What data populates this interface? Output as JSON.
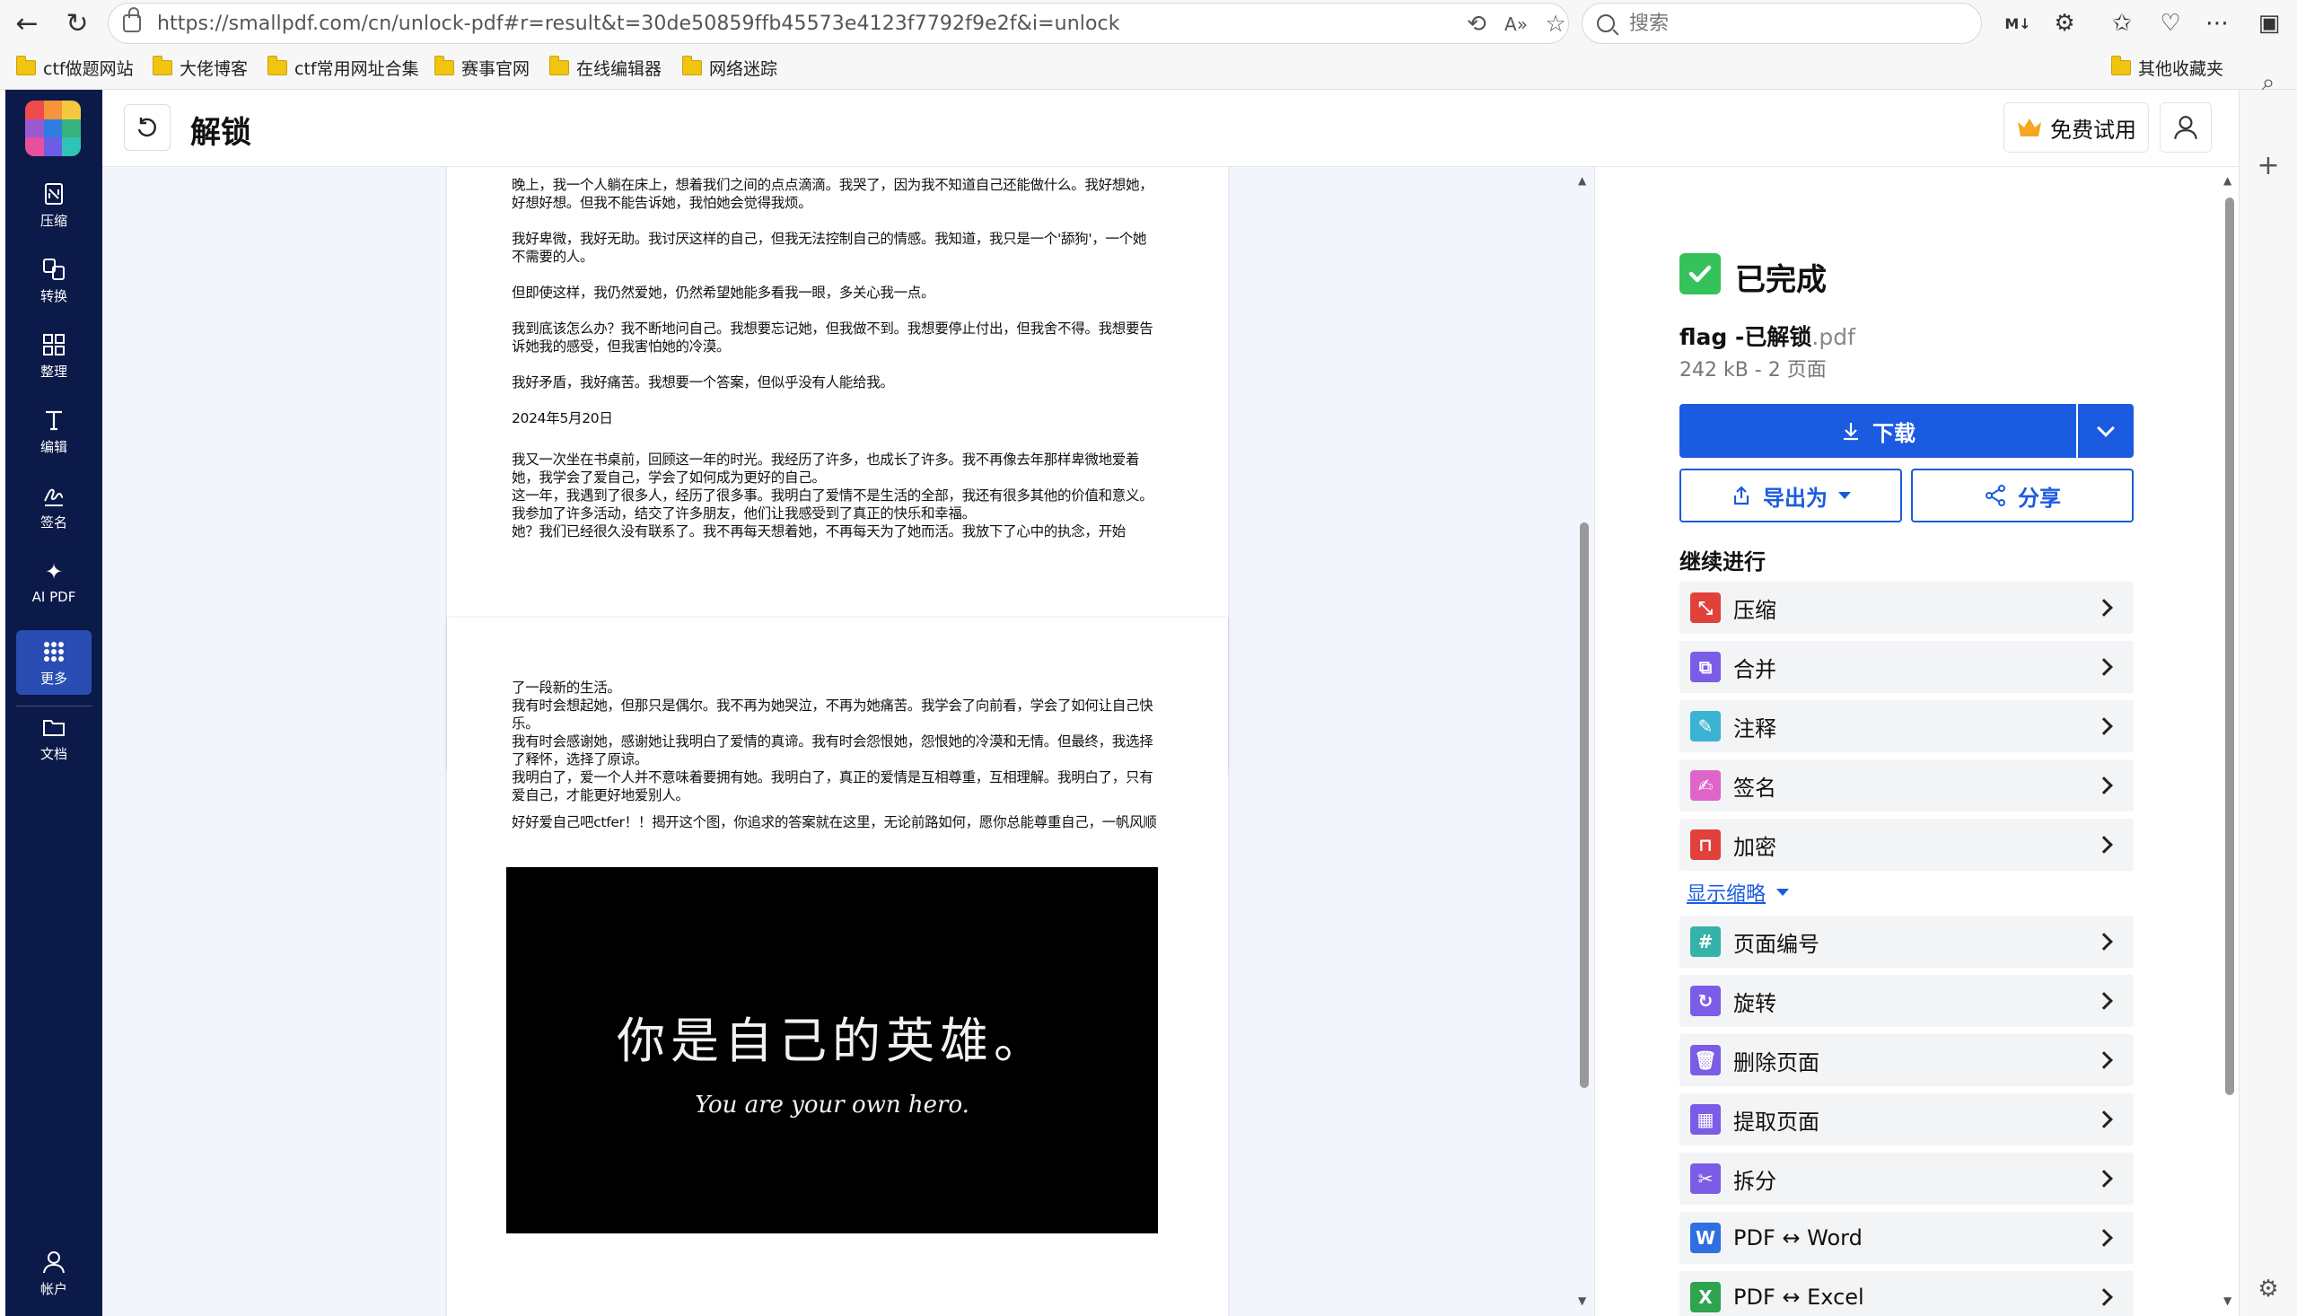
{
  "browser": {
    "url": "https://smallpdf.com/cn/unlock-pdf#r=result&t=30de50859ffb45573e4123f7792f9e2f&i=unlock",
    "search_placeholder": "搜索",
    "bookmarks": [
      "ctf做题网站",
      "大佬博客",
      "ctf常用网址合集",
      "赛事官网",
      "在线编辑器",
      "网络迷踪"
    ],
    "other_bookmarks": "其他收藏夹"
  },
  "sidebar": {
    "items": [
      {
        "label": "压缩",
        "icon": "compress-icon"
      },
      {
        "label": "转换",
        "icon": "convert-icon"
      },
      {
        "label": "整理",
        "icon": "organize-icon"
      },
      {
        "label": "编辑",
        "icon": "edit-icon"
      },
      {
        "label": "签名",
        "icon": "sign-icon"
      },
      {
        "label": "AI PDF",
        "icon": "ai-sparkle-icon"
      },
      {
        "label": "更多",
        "icon": "grid-icon"
      },
      {
        "label": "文档",
        "icon": "folder-icon"
      }
    ],
    "account_label": "帐户"
  },
  "header": {
    "title": "解锁",
    "trial_label": "免费试用"
  },
  "pdf": {
    "page1_paragraphs": [
      "晚上，我一个人躺在床上，想着我们之间的点点滴滴。我哭了，因为我不知道自己还能做什么。我好想她，好想好想。但我不能告诉她，我怕她会觉得我烦。",
      "我好卑微，我好无助。我讨厌这样的自己，但我无法控制自己的情感。我知道，我只是一个'舔狗'，一个她不需要的人。",
      "但即使这样，我仍然爱她，仍然希望她能多看我一眼，多关心我一点。",
      "我到底该怎么办？我不断地问自己。我想要忘记她，但我做不到。我想要停止付出，但我舍不得。我想要告诉她我的感受，但我害怕她的冷漠。",
      "我好矛盾，我好痛苦。我想要一个答案，但似乎没有人能给我。",
      "2024年5月20日",
      "我又一次坐在书桌前，回顾这一年的时光。我经历了许多，也成长了许多。我不再像去年那样卑微地爱着她，我学会了爱自己，学会了如何成为更好的自己。\n这一年，我遇到了很多人，经历了很多事。我明白了爱情不是生活的全部，我还有很多其他的价值和意义。我参加了许多活动，结交了许多朋友，他们让我感受到了真正的快乐和幸福。\n她？我们已经很久没有联系了。我不再每天想着她，不再每天为了她而活。我放下了心中的执念，开始"
    ],
    "page2_paragraphs": [
      "了一段新的生活。\n我有时会想起她，但那只是偶尔。我不再为她哭泣，不再为她痛苦。我学会了向前看，学会了如何让自己快乐。\n我有时会感谢她，感谢她让我明白了爱情的真谛。我有时会怨恨她，怨恨她的冷漠和无情。但最终，我选择了释怀，选择了原谅。\n我明白了，爱一个人并不意味着要拥有她。我明白了，真正的爱情是互相尊重，互相理解。我明白了，只有爱自己，才能更好地爱别人。",
      "好好爱自己吧ctfer！！揭开这个图，你追求的答案就在这里，无论前路如何，愿你总能尊重自己，一帆风顺"
    ],
    "image_text_cn": "你是自己的英雄。",
    "image_text_en": "You are your own hero."
  },
  "result": {
    "status": "已完成",
    "file_base": "flag -已解锁",
    "file_ext": ".pdf",
    "file_meta": "242 kB - 2 页面",
    "download_label": "下载",
    "export_label": "导出为",
    "share_label": "分享",
    "continue_title": "继续进行",
    "show_less": "显示缩略",
    "tools_primary": [
      {
        "label": "压缩",
        "color": "#e0413b"
      },
      {
        "label": "合并",
        "color": "#7b5ce6"
      },
      {
        "label": "注释",
        "color": "#3bb3d3"
      },
      {
        "label": "签名",
        "color": "#e065c8"
      },
      {
        "label": "加密",
        "color": "#e0413b"
      }
    ],
    "tools_more": [
      {
        "label": "页面编号",
        "color": "#35b3a8"
      },
      {
        "label": "旋转",
        "color": "#7b5ce6"
      },
      {
        "label": "删除页面",
        "color": "#7b5ce6"
      },
      {
        "label": "提取页面",
        "color": "#7b5ce6"
      },
      {
        "label": "拆分",
        "color": "#7b5ce6"
      },
      {
        "label": "PDF ↔ Word",
        "color": "#2f6fe0"
      },
      {
        "label": "PDF ↔ Excel",
        "color": "#2ea44f"
      }
    ]
  }
}
